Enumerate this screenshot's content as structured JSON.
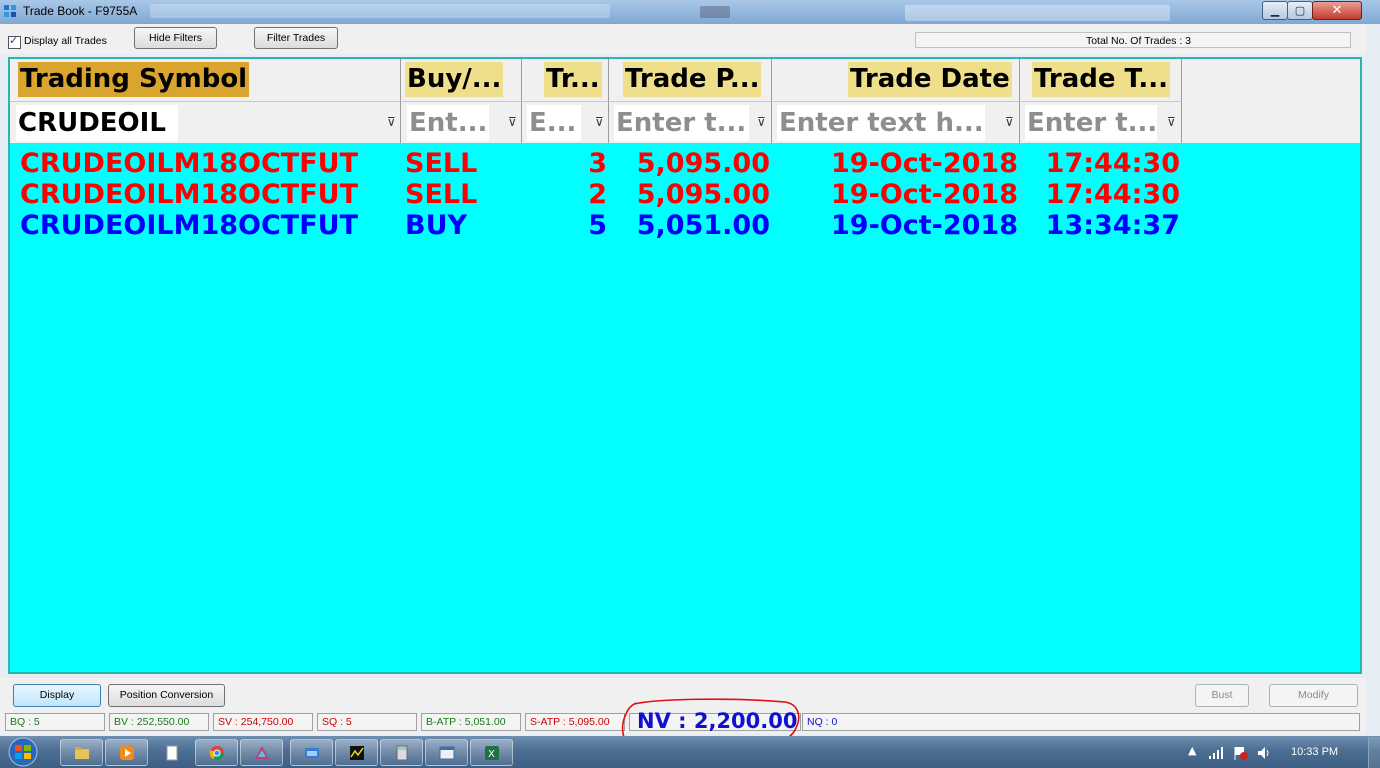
{
  "window": {
    "title": "Trade Book - F9755A",
    "controls": {
      "minimize": "▁",
      "maximize": "▢",
      "close": "✕"
    }
  },
  "toolbar": {
    "display_all_label": "Display all Trades",
    "display_all_checked": true,
    "hide_filters_label": "Hide Filters",
    "filter_trades_label": "Filter Trades",
    "total_trades_text": "Total No. Of Trades : 3"
  },
  "grid": {
    "columns": [
      {
        "header": "Trading Symbol",
        "filter_value": "CRUDEOIL"
      },
      {
        "header": "Buy/...",
        "filter_placeholder": "Ent..."
      },
      {
        "header": "Tr...",
        "filter_placeholder": "E..."
      },
      {
        "header": "Trade P...",
        "filter_placeholder": "Enter t..."
      },
      {
        "header": "Trade Date",
        "filter_placeholder": "Enter text h..."
      },
      {
        "header": "Trade T...",
        "filter_placeholder": "Enter t..."
      }
    ],
    "rows": [
      {
        "symbol": "CRUDEOILM18OCTFUT",
        "side": "SELL",
        "qty": "3",
        "price": "5,095.00",
        "date": "19-Oct-2018",
        "time": "17:44:30",
        "color": "#ff0000"
      },
      {
        "symbol": "CRUDEOILM18OCTFUT",
        "side": "SELL",
        "qty": "2",
        "price": "5,095.00",
        "date": "19-Oct-2018",
        "time": "17:44:30",
        "color": "#ff0000"
      },
      {
        "symbol": "CRUDEOILM18OCTFUT",
        "side": "BUY",
        "qty": "5",
        "price": "5,051.00",
        "date": "19-Oct-2018",
        "time": "13:34:37",
        "color": "#0000ff"
      }
    ],
    "colors": {
      "background": "#00ffff",
      "header_highlight": "#f0df8a",
      "symbol_header_highlight": "#d9a52e",
      "sell": "#ff0000",
      "buy": "#0000ff"
    }
  },
  "actions": {
    "display_label": "Display",
    "position_conversion_label": "Position Conversion",
    "bust_label": "Bust",
    "modify_label": "Modify"
  },
  "status": {
    "bq": "BQ : 5",
    "bv": "BV : 252,550.00",
    "sv": "SV : 254,750.00",
    "sq": "SQ : 5",
    "batp": "B-ATP : 5,051.00",
    "satp": "S-ATP : 5,095.00",
    "nv": "NV : 2,200.00",
    "nq": "NQ : 0"
  },
  "taskbar": {
    "items": [
      "explorer-icon",
      "media-player-icon",
      "document-icon",
      "chrome-icon",
      "app-triangle-icon",
      "app-window-icon",
      "chart-app-icon",
      "calculator-icon",
      "window-app-icon",
      "excel-icon"
    ],
    "clock": "10:33 PM"
  }
}
